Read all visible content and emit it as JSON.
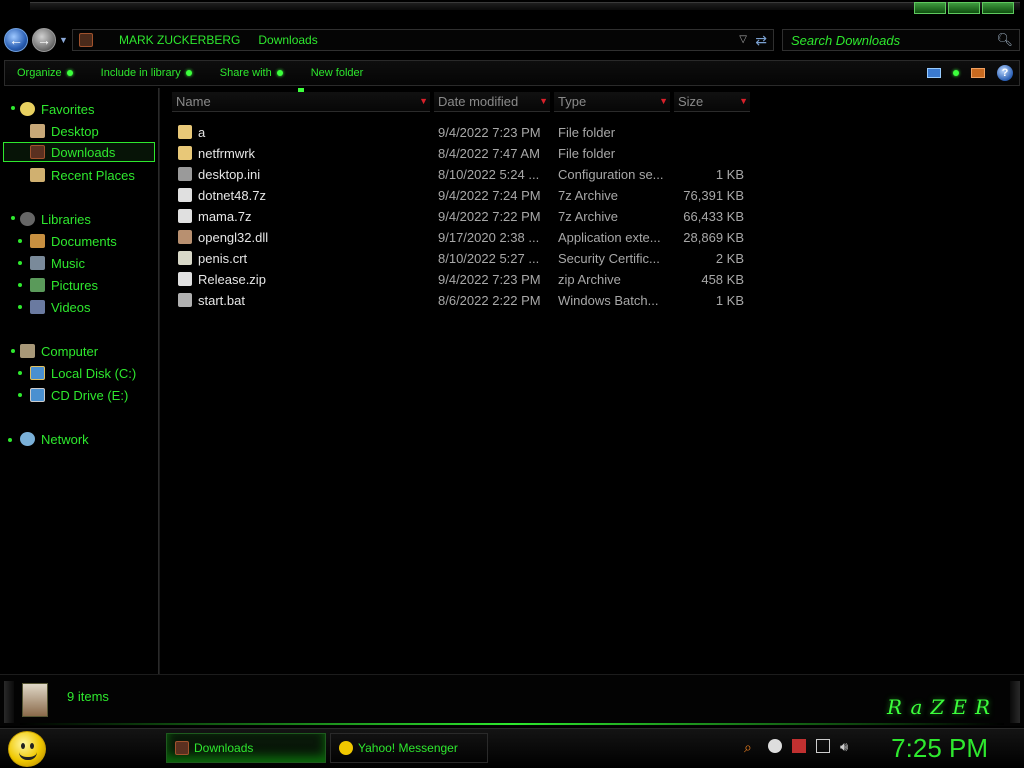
{
  "window": {
    "breadcrumbs": [
      "MARK ZUCKERBERG",
      "Downloads"
    ],
    "search_placeholder": "Search Downloads"
  },
  "toolbar": {
    "organize": "Organize",
    "include_in_library": "Include in library",
    "share_with": "Share with",
    "new_folder": "New folder",
    "help": "?"
  },
  "sidebar": {
    "favorites": {
      "label": "Favorites",
      "items": [
        {
          "label": "Desktop"
        },
        {
          "label": "Downloads"
        },
        {
          "label": "Recent Places"
        }
      ]
    },
    "libraries": {
      "label": "Libraries",
      "items": [
        {
          "label": "Documents"
        },
        {
          "label": "Music"
        },
        {
          "label": "Pictures"
        },
        {
          "label": "Videos"
        }
      ]
    },
    "computer": {
      "label": "Computer",
      "items": [
        {
          "label": "Local Disk (C:)"
        },
        {
          "label": "CD Drive (E:)"
        }
      ]
    },
    "network": {
      "label": "Network"
    }
  },
  "columns": {
    "name": "Name",
    "date_modified": "Date modified",
    "type": "Type",
    "size": "Size"
  },
  "files": [
    {
      "name": "a",
      "date": "9/4/2022 7:23 PM",
      "type": "File folder",
      "size": "",
      "icon": "folder-icon",
      "color": "#e8c878"
    },
    {
      "name": "netfrmwrk",
      "date": "8/4/2022 7:47 AM",
      "type": "File folder",
      "size": "",
      "icon": "folder-icon",
      "color": "#e8c878"
    },
    {
      "name": "desktop.ini",
      "date": "8/10/2022 5:24 ...",
      "type": "Configuration se...",
      "size": "1 KB",
      "icon": "settings-file-icon",
      "color": "#9a9a9a"
    },
    {
      "name": "dotnet48.7z",
      "date": "9/4/2022 7:24 PM",
      "type": "7z Archive",
      "size": "76,391 KB",
      "icon": "archive-icon",
      "color": "#e0e0e0"
    },
    {
      "name": "mama.7z",
      "date": "9/4/2022 7:22 PM",
      "type": "7z Archive",
      "size": "66,433 KB",
      "icon": "archive-icon",
      "color": "#e0e0e0"
    },
    {
      "name": "opengl32.dll",
      "date": "9/17/2020 2:38 ...",
      "type": "Application exte...",
      "size": "28,869 KB",
      "icon": "dll-icon",
      "color": "#b89070"
    },
    {
      "name": "penis.crt",
      "date": "8/10/2022 5:27 ...",
      "type": "Security Certific...",
      "size": "2 KB",
      "icon": "certificate-icon",
      "color": "#d8d8c8"
    },
    {
      "name": "Release.zip",
      "date": "9/4/2022 7:23 PM",
      "type": "zip Archive",
      "size": "458 KB",
      "icon": "zip-icon",
      "color": "#e0e0e0"
    },
    {
      "name": "start.bat",
      "date": "8/6/2022 2:22 PM",
      "type": "Windows Batch...",
      "size": "1 KB",
      "icon": "batch-icon",
      "color": "#b0b0b0"
    }
  ],
  "details": {
    "item_count": "9 items",
    "brand": "RaZER"
  },
  "taskbar": {
    "buttons": [
      {
        "label": "Downloads"
      },
      {
        "label": "Yahoo! Messenger"
      }
    ],
    "clock": "7:25 PM"
  },
  "colors": {
    "accent": "#2ee82e",
    "header_text": "#8a8a8a",
    "sort_arrow": "#d8202a",
    "background": "#000000"
  }
}
